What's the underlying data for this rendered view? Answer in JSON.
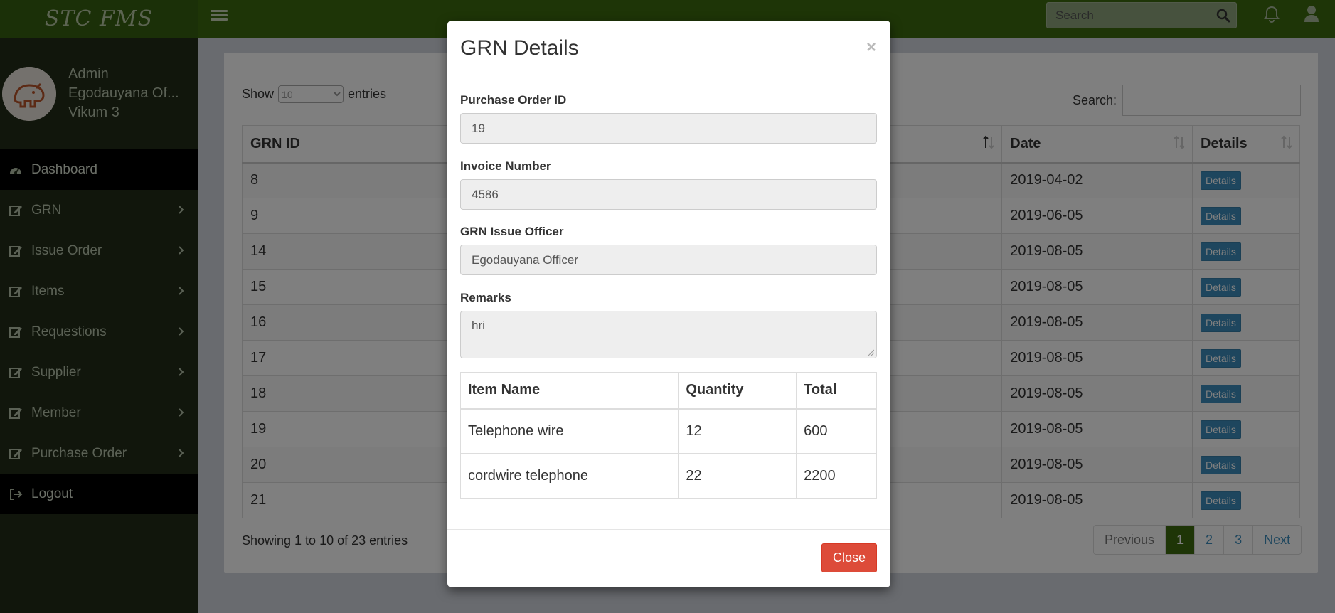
{
  "header": {
    "logo_text": "STC FMS",
    "search_placeholder": "Search",
    "icons": [
      "hamburger-icon",
      "search-icon",
      "bell-icon",
      "user-icon"
    ],
    "brand_color": "#3d6b0f"
  },
  "sidebar": {
    "user": {
      "role": "Admin",
      "name": "Egodauyana Of...",
      "sub": "Vikum 3"
    },
    "items": [
      {
        "label": "Dashboard",
        "icon": "dashboard-icon",
        "active": true,
        "has_children": false
      },
      {
        "label": "GRN",
        "icon": "edit-icon",
        "active": false,
        "has_children": true
      },
      {
        "label": "Issue Order",
        "icon": "edit-icon",
        "active": false,
        "has_children": true
      },
      {
        "label": "Items",
        "icon": "edit-icon",
        "active": false,
        "has_children": true
      },
      {
        "label": "Requestions",
        "icon": "edit-icon",
        "active": false,
        "has_children": true
      },
      {
        "label": "Supplier",
        "icon": "edit-icon",
        "active": false,
        "has_children": true
      },
      {
        "label": "Member",
        "icon": "edit-icon",
        "active": false,
        "has_children": true
      },
      {
        "label": "Purchase Order",
        "icon": "edit-icon",
        "active": false,
        "has_children": true
      },
      {
        "label": "Logout",
        "icon": "logout-icon",
        "active": true,
        "has_children": false
      }
    ]
  },
  "table": {
    "show_label": "Show",
    "entries_label": "entries",
    "page_size": "10",
    "search_label": "Search:",
    "columns": [
      "GRN ID",
      "Date",
      "Details"
    ],
    "rows": [
      {
        "id": "8",
        "date": "2019-04-02",
        "action": "Details"
      },
      {
        "id": "9",
        "date": "2019-06-05",
        "action": "Details"
      },
      {
        "id": "14",
        "date": "2019-08-05",
        "action": "Details"
      },
      {
        "id": "15",
        "date": "2019-08-05",
        "action": "Details"
      },
      {
        "id": "16",
        "date": "2019-08-05",
        "action": "Details"
      },
      {
        "id": "17",
        "date": "2019-08-05",
        "action": "Details"
      },
      {
        "id": "18",
        "date": "2019-08-05",
        "action": "Details"
      },
      {
        "id": "19",
        "date": "2019-08-05",
        "action": "Details"
      },
      {
        "id": "20",
        "date": "2019-08-05",
        "action": "Details"
      },
      {
        "id": "21",
        "date": "2019-08-05",
        "action": "Details"
      }
    ],
    "info": "Showing 1 to 10 of 23 entries",
    "pagination": [
      "Previous",
      "1",
      "2",
      "3",
      "Next"
    ],
    "current_page": "1"
  },
  "modal": {
    "title": "GRN Details",
    "close_x": "×",
    "fields": {
      "po_label": "Purchase Order ID",
      "po_value": "19",
      "invoice_label": "Invoice Number",
      "invoice_value": "4586",
      "officer_label": "GRN Issue Officer",
      "officer_value": "Egodauyana Officer",
      "remarks_label": "Remarks",
      "remarks_value": "hri"
    },
    "items_columns": [
      "Item Name",
      "Quantity",
      "Total"
    ],
    "items": [
      {
        "name": "Telephone wire",
        "quantity": "12",
        "total": "600"
      },
      {
        "name": "cordwire telephone",
        "quantity": "22",
        "total": "2200"
      }
    ],
    "close_label": "Close",
    "close_color": "#dd4b39"
  }
}
